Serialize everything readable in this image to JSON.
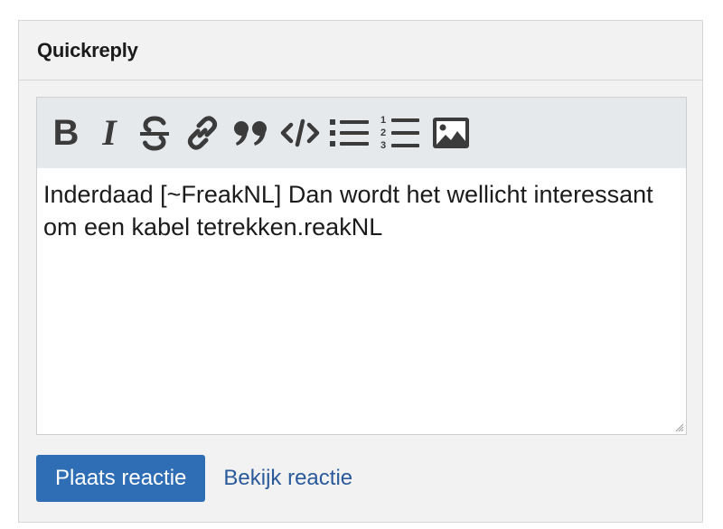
{
  "panel": {
    "title": "Quickreply"
  },
  "toolbar": {
    "buttons": [
      {
        "name": "bold",
        "icon": "bold-icon",
        "glyph": "B"
      },
      {
        "name": "italic",
        "icon": "italic-icon",
        "glyph": "I"
      },
      {
        "name": "strikethrough",
        "icon": "strikethrough-icon"
      },
      {
        "name": "link",
        "icon": "link-icon"
      },
      {
        "name": "quote",
        "icon": "quote-icon"
      },
      {
        "name": "code",
        "icon": "code-icon"
      },
      {
        "name": "bullet-list",
        "icon": "bullet-list-icon"
      },
      {
        "name": "numbered-list",
        "icon": "numbered-list-icon"
      },
      {
        "name": "image",
        "icon": "image-icon"
      }
    ]
  },
  "editor": {
    "text": "Inderdaad [~FreakNL] Dan wordt het wellicht interessant om een kabel tetrekken.reakNL"
  },
  "actions": {
    "submit_label": "Plaats reactie",
    "preview_label": "Bekijk reactie"
  },
  "colors": {
    "primary_button": "#2f6db5",
    "link": "#2b5a9b",
    "toolbar_bg": "#e6e9ec",
    "panel_bg": "#f2f2f2"
  }
}
